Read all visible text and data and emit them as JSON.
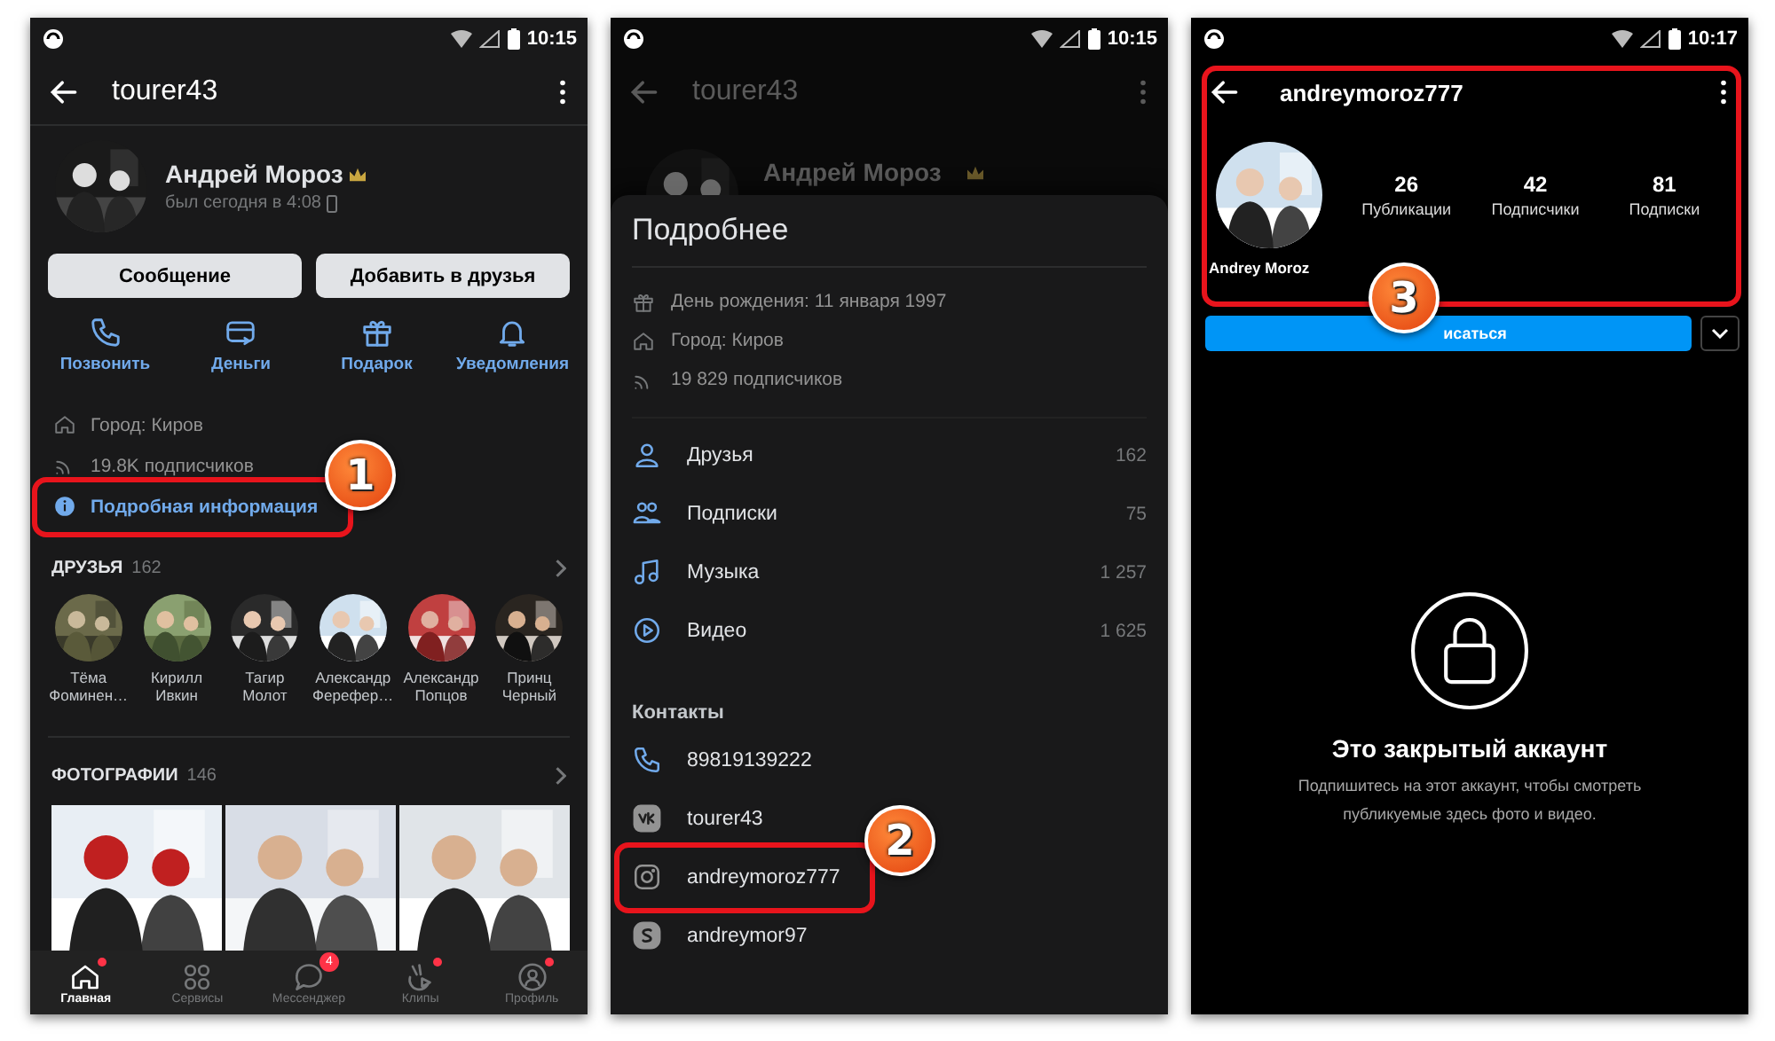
{
  "screen_1": {
    "status_time": "10:15",
    "title": "tourer43",
    "name": "Андрей Мороз",
    "last_seen": "был сегодня в 4:08",
    "buttons": [
      "Сообщение",
      "Добавить в друзья"
    ],
    "actions": [
      {
        "kind": "call",
        "label": "Позвонить"
      },
      {
        "kind": "money",
        "label": "Деньги"
      },
      {
        "kind": "gift",
        "label": "Подарок"
      },
      {
        "kind": "bell",
        "label": "Уведомления"
      }
    ],
    "info": [
      {
        "kind": "home",
        "text": "Город: Киров"
      },
      {
        "kind": "rss",
        "text": "19.8K подписчиков"
      }
    ],
    "details_link": "Подробная информация",
    "callout": "1",
    "friends": {
      "title": "ДРУЗЬЯ",
      "count": "162",
      "items": [
        {
          "name": "Тёма Фоминен…"
        },
        {
          "name": "Кирилл Ивкин"
        },
        {
          "name": "Тагир Молот"
        },
        {
          "name": "Александр Ферефер…"
        },
        {
          "name": "Александр Попцов"
        },
        {
          "name": "Принц Черный"
        }
      ]
    },
    "photos": {
      "title": "ФОТОГРАФИИ",
      "count": "146"
    },
    "nav": [
      {
        "kind": "home",
        "label": "Главная",
        "selected": true,
        "dot": true
      },
      {
        "kind": "services",
        "label": "Сервисы",
        "selected": false,
        "dot": false
      },
      {
        "kind": "chat",
        "label": "Мессенджер",
        "selected": false,
        "dot": false,
        "badge": "4"
      },
      {
        "kind": "clips",
        "label": "Клипы",
        "selected": false,
        "dot": true
      },
      {
        "kind": "profile",
        "label": "Профиль",
        "selected": false,
        "dot": true
      }
    ]
  },
  "screen_2": {
    "status_time": "10:15",
    "title": "tourer43",
    "name": "Андрей Мороз",
    "sheet_title": "Подробнее",
    "info": [
      {
        "kind": "gift",
        "text": "День рождения: 11 января 1997"
      },
      {
        "kind": "home",
        "text": "Город: Киров"
      },
      {
        "kind": "rss",
        "text": "19 829 подписчиков"
      }
    ],
    "counters": [
      {
        "kind": "friends",
        "label": "Друзья",
        "count": "162"
      },
      {
        "kind": "subs",
        "label": "Подписки",
        "count": "75"
      },
      {
        "kind": "music",
        "label": "Музыка",
        "count": "1 257"
      },
      {
        "kind": "video",
        "label": "Видео",
        "count": "1 625"
      }
    ],
    "contacts_title": "Контакты",
    "contacts": [
      {
        "kind": "phone",
        "text": "89819139222"
      },
      {
        "kind": "vk",
        "text": "tourer43"
      },
      {
        "kind": "instagram",
        "text": "andreymoroz777"
      },
      {
        "kind": "skype",
        "text": "andreymor97"
      }
    ],
    "callout": "2"
  },
  "screen_3": {
    "status_time": "10:17",
    "username": "andreymoroz777",
    "stats": [
      {
        "value": "26",
        "label": "Публикации"
      },
      {
        "value": "42",
        "label": "Подписчики"
      },
      {
        "value": "81",
        "label": "Подписки"
      }
    ],
    "full_name": "Andrey Moroz",
    "follow_button": "исаться",
    "callout": "3",
    "private_title": "Это закрытый аккаунт",
    "private_text": "Подпишитесь на этот аккаунт, чтобы смотреть публикуемые здесь фото и видео."
  }
}
